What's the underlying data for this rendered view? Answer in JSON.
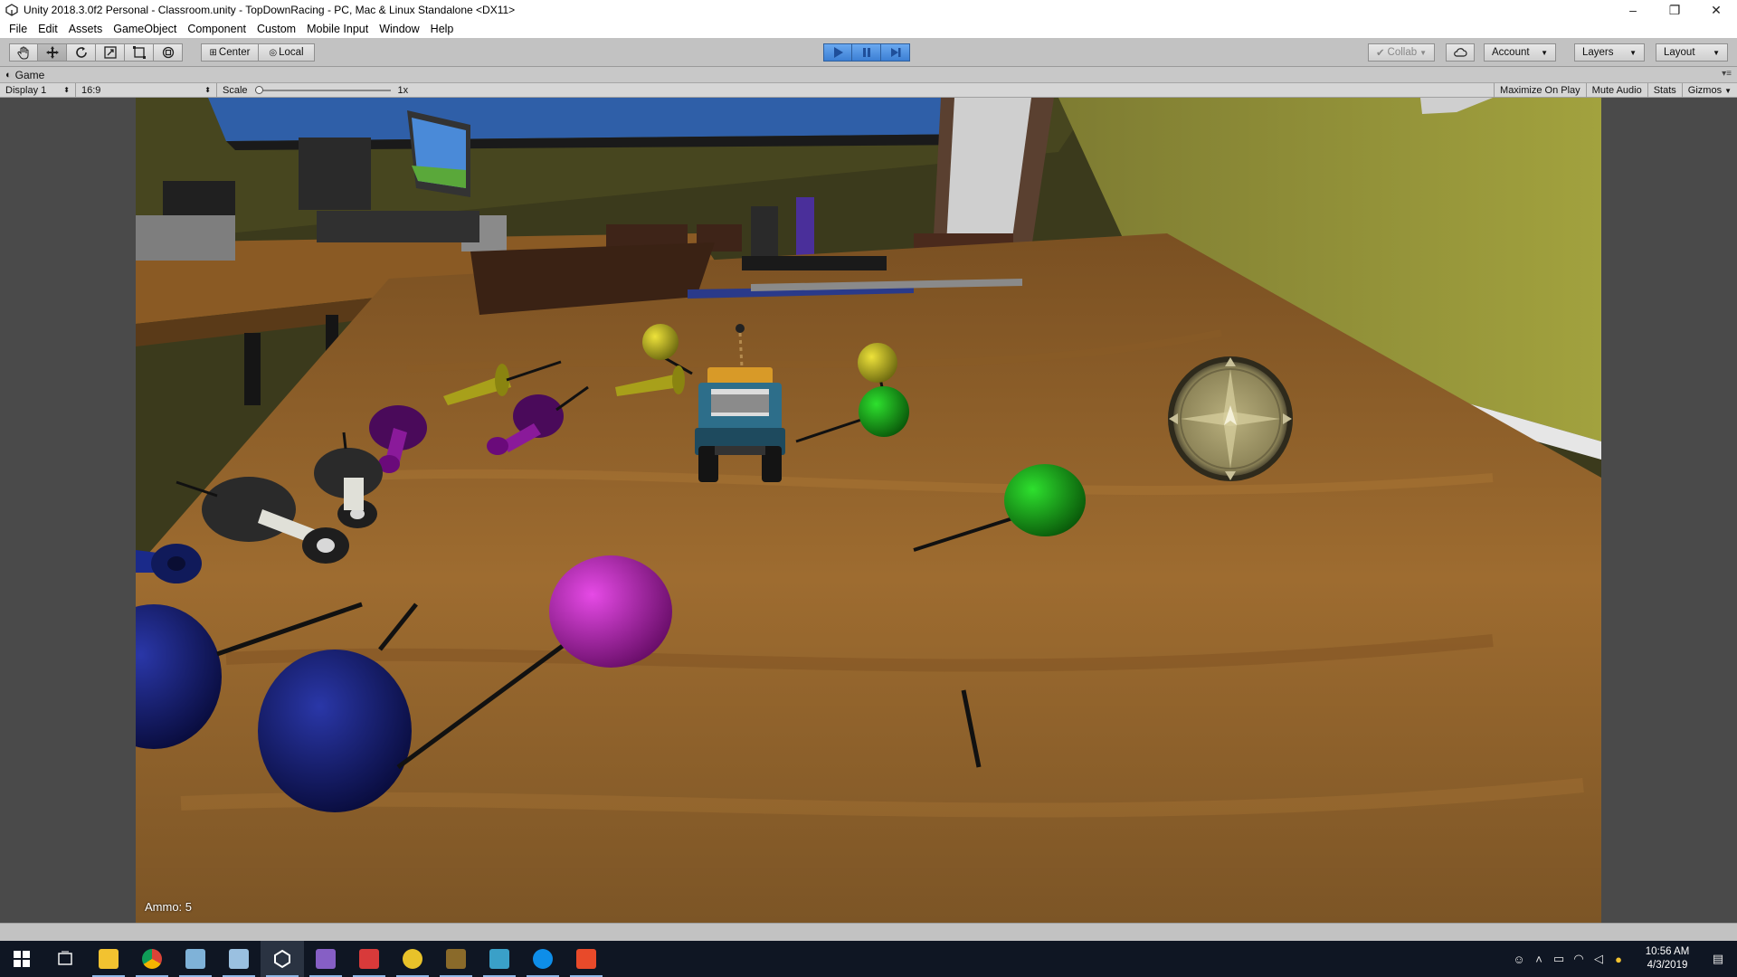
{
  "window": {
    "title": "Unity 2018.3.0f2 Personal - Classroom.unity - TopDownRacing - PC, Mac & Linux Standalone <DX11>",
    "controls": [
      "–",
      "❐",
      "✕"
    ]
  },
  "menu": [
    "File",
    "Edit",
    "Assets",
    "GameObject",
    "Component",
    "Custom",
    "Mobile Input",
    "Window",
    "Help"
  ],
  "toolbar": {
    "tools": [
      "hand-tool-icon",
      "move-tool-icon",
      "rotate-tool-icon",
      "scale-tool-icon",
      "rect-tool-icon",
      "transform-tool-icon"
    ],
    "pivot_label": "Center",
    "space_label": "Local",
    "play_state": "playing",
    "collab_label": "Collab",
    "account_label": "Account",
    "layers_label": "Layers",
    "layout_label": "Layout"
  },
  "game_tab": {
    "label": "Game"
  },
  "game_bar": {
    "display": "Display 1",
    "aspect": "16:9",
    "scale_label": "Scale",
    "scale_value": "1x",
    "maximize": "Maximize On Play",
    "mute": "Mute Audio",
    "stats": "Stats",
    "gizmos": "Gizmos"
  },
  "hud": {
    "ammo": "Ammo: 5"
  },
  "taskbar": {
    "apps": [
      "start-icon",
      "task-view-icon",
      "file-explorer-icon",
      "chrome-icon",
      "notepad-icon",
      "paint-icon",
      "unity-icon",
      "visual-studio-icon",
      "gift-app-icon",
      "money-app-icon",
      "game-app-icon",
      "editor-app-icon",
      "teamviewer-icon",
      "snip-app-icon"
    ],
    "time": "10:56 AM",
    "date": "4/3/2019"
  },
  "colors": {
    "unity_chrome": "#c2c2c2",
    "play_accent": "#3c7fd4",
    "taskbar": "#0f1623",
    "table_wood": "#9a6a2e",
    "wall": "#8a8a38"
  }
}
